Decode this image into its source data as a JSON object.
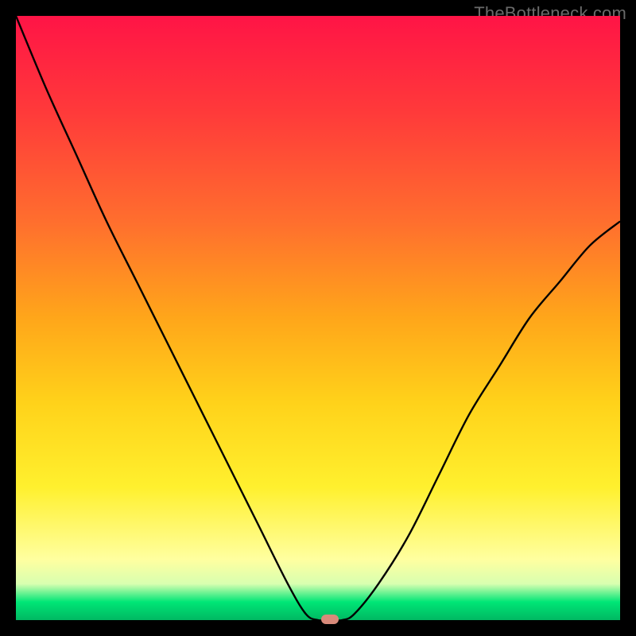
{
  "credit": "TheBottleneck.com",
  "colors": {
    "frame_bg": "#000000",
    "gradient_top": "#ff1446",
    "gradient_mid": "#ffd21a",
    "gradient_bottom": "#00b862",
    "curve_stroke": "#000000",
    "marker_fill": "#d88a7a",
    "credit_text": "#6a6a6a"
  },
  "chart_data": {
    "type": "line",
    "title": "",
    "xlabel": "",
    "ylabel": "",
    "xlim": [
      0,
      100
    ],
    "ylim": [
      0,
      100
    ],
    "grid": false,
    "legend": false,
    "x": [
      0,
      5,
      10,
      15,
      20,
      25,
      30,
      35,
      40,
      45,
      48,
      50,
      52,
      54,
      56,
      60,
      65,
      70,
      75,
      80,
      85,
      90,
      95,
      100
    ],
    "values": [
      100,
      88,
      77,
      66,
      56,
      46,
      36,
      26,
      16,
      6,
      1,
      0,
      0,
      0,
      1,
      6,
      14,
      24,
      34,
      42,
      50,
      56,
      62,
      66
    ],
    "annotations": [
      {
        "type": "marker",
        "x": 52,
        "y": 0,
        "label": ""
      }
    ]
  }
}
